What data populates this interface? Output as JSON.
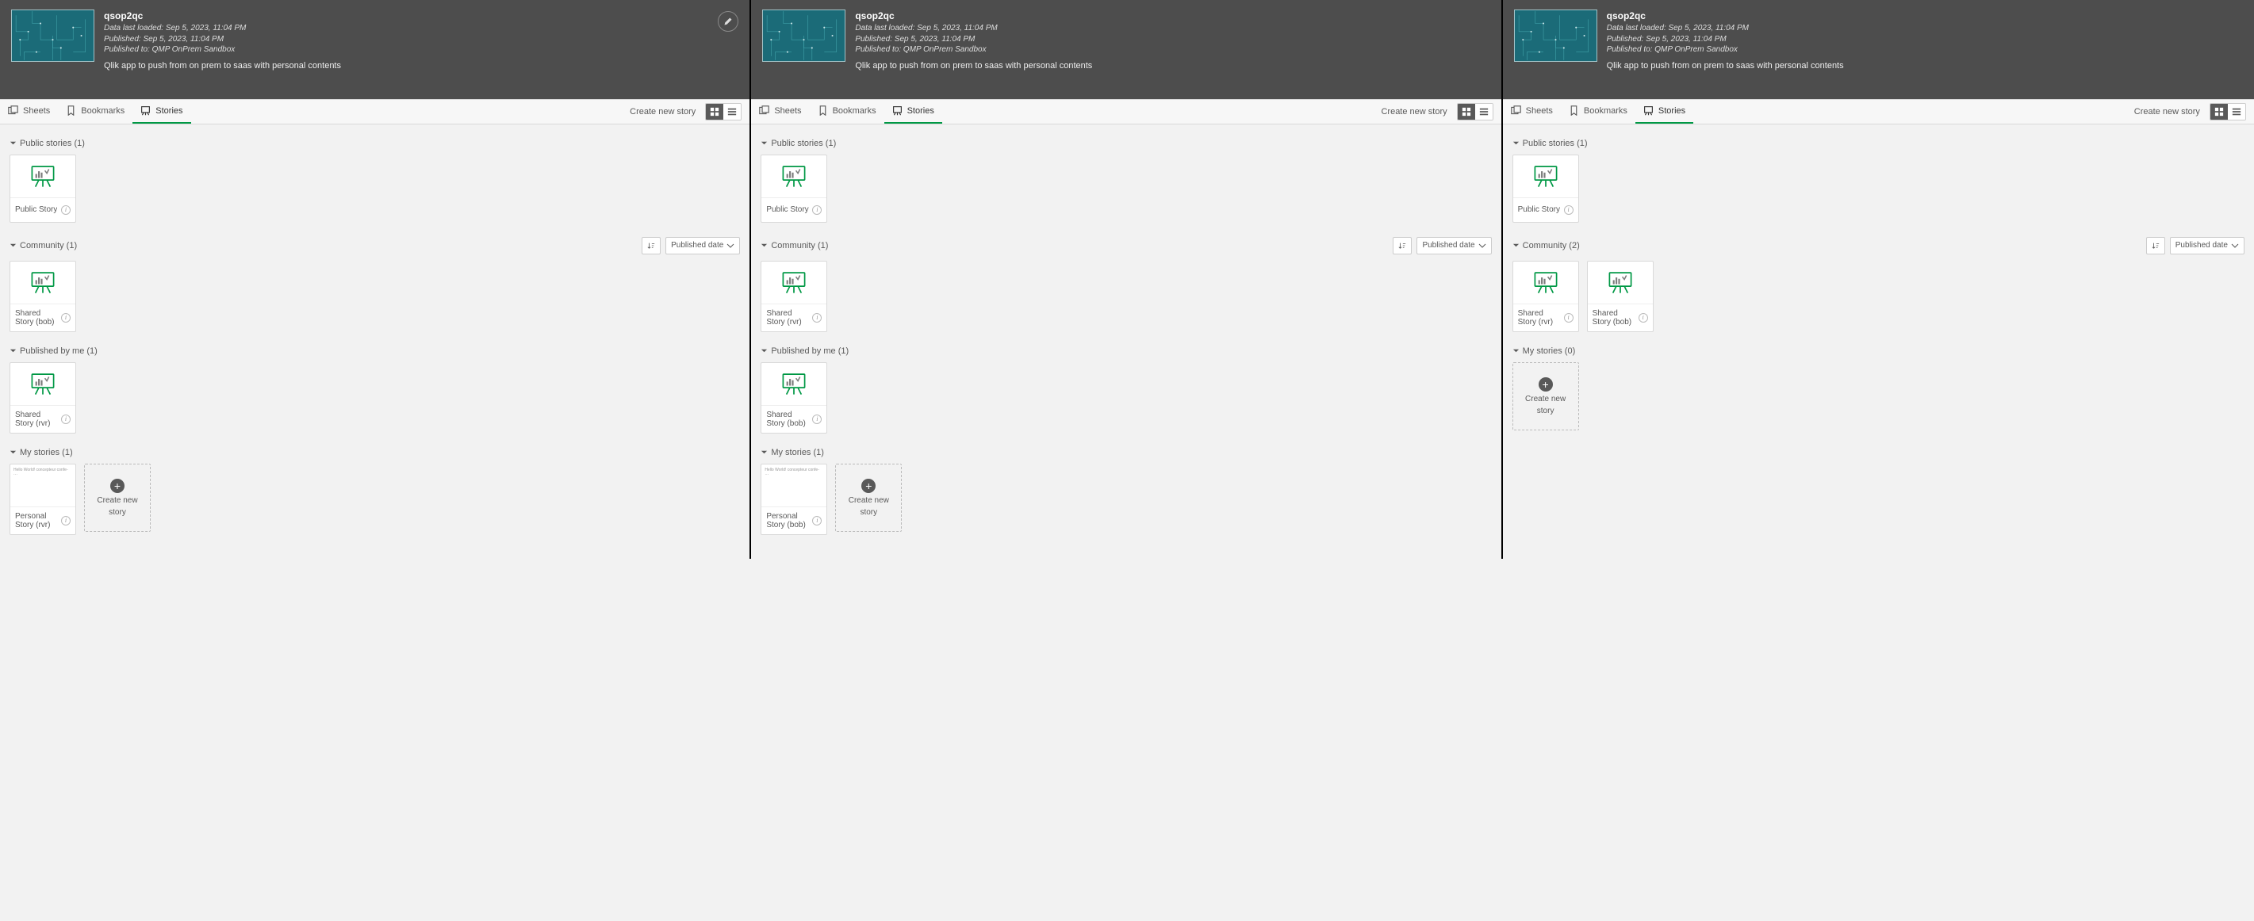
{
  "header": {
    "title": "qsop2qc",
    "loaded": "Data last loaded: Sep 5, 2023, 11:04 PM",
    "published": "Published: Sep 5, 2023, 11:04 PM",
    "published_to": "Published to: QMP OnPrem Sandbox",
    "desc": "Qlik app to push from on prem to saas with personal contents"
  },
  "toolbar": {
    "sheets": "Sheets",
    "bookmarks": "Bookmarks",
    "stories": "Stories",
    "create": "Create new story"
  },
  "sort": {
    "label": "Published date"
  },
  "create_card": {
    "line1": "Create new",
    "line2": "story"
  },
  "thumb_text": "Hello World! concepteur confe- ···",
  "panels": [
    {
      "show_edit": true,
      "sections": [
        {
          "title": "Public stories (1)",
          "sort": false,
          "cards": [
            {
              "kind": "story",
              "label": "Public Story"
            }
          ]
        },
        {
          "title": "Community (1)",
          "sort": true,
          "cards": [
            {
              "kind": "story",
              "label": "Shared Story (bob)"
            }
          ]
        },
        {
          "title": "Published by me (1)",
          "sort": false,
          "cards": [
            {
              "kind": "story",
              "label": "Shared Story (rvr)"
            }
          ]
        },
        {
          "title": "My stories (1)",
          "sort": false,
          "cards": [
            {
              "kind": "text",
              "label": "Personal Story (rvr)"
            },
            {
              "kind": "create"
            }
          ]
        }
      ]
    },
    {
      "show_edit": false,
      "sections": [
        {
          "title": "Public stories (1)",
          "sort": false,
          "cards": [
            {
              "kind": "story",
              "label": "Public Story"
            }
          ]
        },
        {
          "title": "Community (1)",
          "sort": true,
          "cards": [
            {
              "kind": "story",
              "label": "Shared Story (rvr)"
            }
          ]
        },
        {
          "title": "Published by me (1)",
          "sort": false,
          "cards": [
            {
              "kind": "story",
              "label": "Shared Story (bob)"
            }
          ]
        },
        {
          "title": "My stories (1)",
          "sort": false,
          "cards": [
            {
              "kind": "text",
              "label": "Personal Story (bob)"
            },
            {
              "kind": "create"
            }
          ]
        }
      ]
    },
    {
      "show_edit": false,
      "sections": [
        {
          "title": "Public stories (1)",
          "sort": false,
          "cards": [
            {
              "kind": "story",
              "label": "Public Story"
            }
          ]
        },
        {
          "title": "Community (2)",
          "sort": true,
          "cards": [
            {
              "kind": "story",
              "label": "Shared Story (rvr)"
            },
            {
              "kind": "story",
              "label": "Shared Story (bob)"
            }
          ]
        },
        {
          "title": "My stories (0)",
          "sort": false,
          "cards": [
            {
              "kind": "create"
            }
          ]
        }
      ]
    }
  ]
}
